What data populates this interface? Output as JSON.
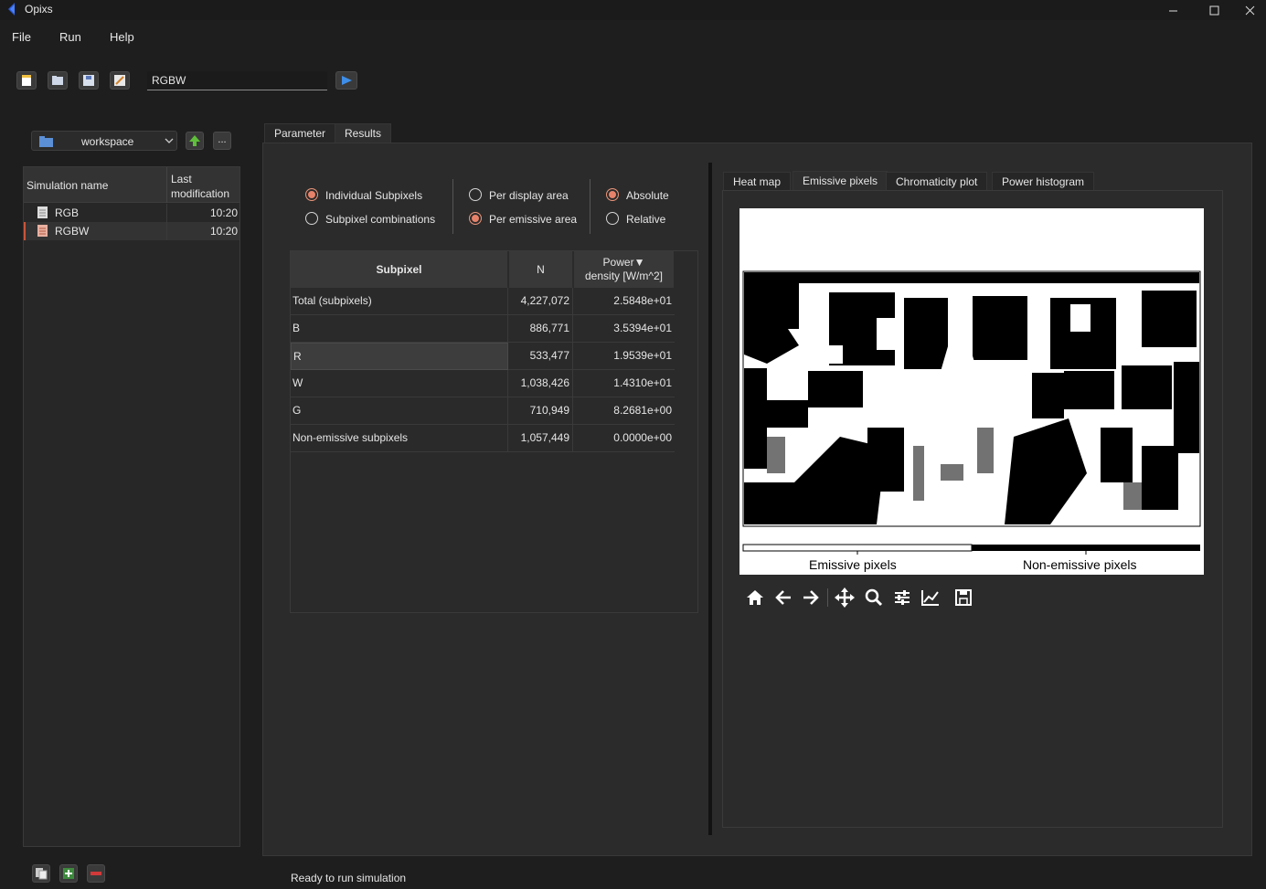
{
  "window": {
    "title": "Opixs"
  },
  "menu": [
    {
      "label": "File"
    },
    {
      "label": "Run"
    },
    {
      "label": "Help"
    }
  ],
  "toolbar": {
    "simulation_input_value": "RGBW",
    "icons": [
      "new-file-icon",
      "open-folder-icon",
      "save-icon",
      "edit-icon",
      "run-play-icon"
    ]
  },
  "sidebar": {
    "workspace_combo": "workspace",
    "more_button": "...",
    "columns": {
      "name": "Simulation name",
      "modified": "Last modification"
    },
    "simulations": [
      {
        "name": "RGB",
        "modified": "10:20"
      },
      {
        "name": "RGBW",
        "modified": "10:20"
      }
    ]
  },
  "main_tabs": [
    {
      "label": "Parameter"
    },
    {
      "label": "Results",
      "active": true
    }
  ],
  "options": {
    "group1": [
      {
        "label": "Individual Subpixels",
        "checked": true
      },
      {
        "label": "Subpixel combinations",
        "checked": false
      }
    ],
    "group2": [
      {
        "label": "Per display area",
        "checked": false
      },
      {
        "label": "Per emissive area",
        "checked": true
      }
    ],
    "group3": [
      {
        "label": "Absolute",
        "checked": true
      },
      {
        "label": "Relative",
        "checked": false
      }
    ]
  },
  "table": {
    "headers": {
      "subpixel": "Subpixel",
      "n": "N",
      "power_line1": "Power",
      "power_line2": "density [W/m^2]",
      "sort_indicator": "▼"
    },
    "rows": [
      {
        "subpixel": "Total (subpixels)",
        "n": "4,227,072",
        "power": "2.5848e+01"
      },
      {
        "subpixel": "B",
        "n": "886,771",
        "power": "3.5394e+01"
      },
      {
        "subpixel": "R",
        "n": "533,477",
        "power": "1.9539e+01",
        "selected": true
      },
      {
        "subpixel": "W",
        "n": "1,038,426",
        "power": "1.4310e+01"
      },
      {
        "subpixel": "G",
        "n": "710,949",
        "power": "8.2681e+00"
      },
      {
        "subpixel": "Non-emissive subpixels",
        "n": "1,057,449",
        "power": "0.0000e+00"
      }
    ]
  },
  "plot_tabs": [
    {
      "label": "Heat map"
    },
    {
      "label": "Emissive pixels",
      "active": true
    },
    {
      "label": "Chromaticity plot"
    },
    {
      "label": "Power histogram"
    }
  ],
  "plot": {
    "legend_left": "Emissive pixels",
    "legend_right": "Non-emissive pixels",
    "tools": [
      "home-icon",
      "back-arrow-icon",
      "forward-arrow-icon",
      "pan-move-icon",
      "zoom-magnifier-icon",
      "configure-subplots-icon",
      "edit-axis-icon",
      "save-figure-icon"
    ]
  },
  "status": {
    "text": "Ready to run simulation"
  },
  "colors": {
    "accent_radio": "#e7826a",
    "background": "#1e1e1e",
    "panel": "#2b2b2b"
  }
}
